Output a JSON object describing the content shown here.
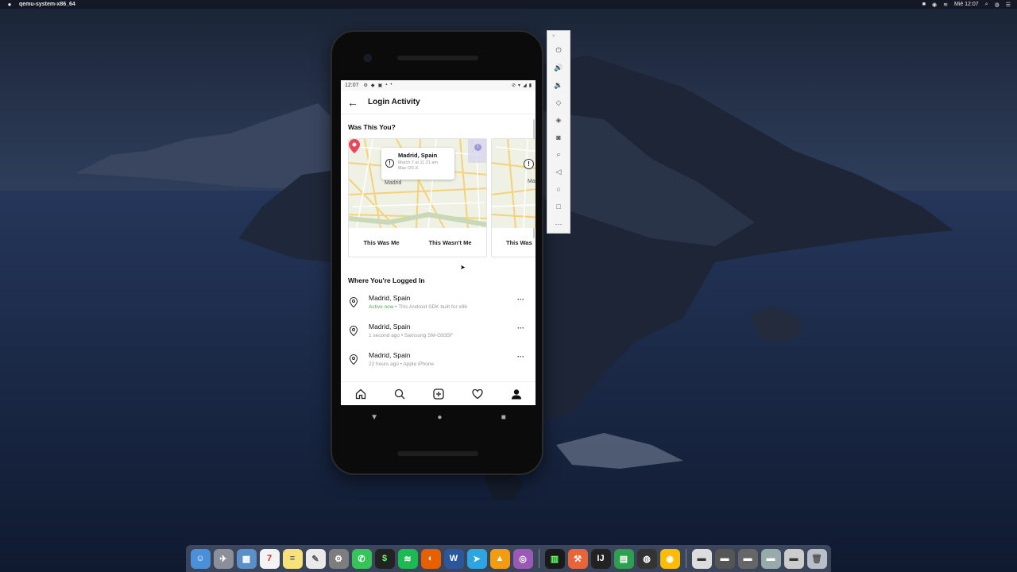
{
  "menubar": {
    "app_name": "qemu-system-x86_64",
    "clock": "Mié 12:07"
  },
  "phone_status": {
    "time": "12:07"
  },
  "appbar": {
    "title": "Login Activity"
  },
  "was_this_you": {
    "title": "Was This You?",
    "cards": [
      {
        "city": "Madrid, Spain",
        "time": "March 7 at 11:21 am",
        "device": "Mac OS X",
        "map_label": "Madrid",
        "confirm_label": "This Was Me",
        "deny_label": "This Wasn't Me"
      },
      {
        "map_label": "Ma",
        "confirm_label": "This Was"
      }
    ]
  },
  "logged_in": {
    "title": "Where You're Logged In",
    "sessions": [
      {
        "city": "Madrid, Spain",
        "status": "Active now",
        "detail": " • This Android SDK built for x86"
      },
      {
        "city": "Madrid, Spain",
        "status": "",
        "detail": "1 second ago • Samsung SM-G935F"
      },
      {
        "city": "Madrid, Spain",
        "status": "",
        "detail": "22 hours ago • Apple iPhone"
      }
    ]
  },
  "bottom_nav": [
    "home-icon",
    "search-icon",
    "add-post-icon",
    "activity-heart-icon",
    "profile-icon"
  ],
  "emulator_toolbar": [
    "power-icon",
    "volume-up-icon",
    "volume-down-icon",
    "rotate-left-icon",
    "rotate-right-icon",
    "camera-icon",
    "zoom-icon",
    "back-icon",
    "home-icon",
    "overview-icon",
    "more-icon"
  ],
  "dock_apps": [
    "Finder",
    "Launchpad",
    "Preview",
    "Calendar",
    "Notes",
    "TextEdit",
    "System Preferences",
    "WhatsApp",
    "Terminal",
    "Spotify",
    "Firefox",
    "Word",
    "Telegram",
    "VLC",
    "Podcasts",
    "Activity Monitor",
    "Instruments",
    "IntelliJ IDEA",
    "Numbers",
    "OBS",
    "Chrome",
    "Folder",
    "Folder",
    "Folder",
    "Folder",
    "Folder",
    "Trash"
  ],
  "colors": {
    "active_green": "#4caf50",
    "pin_red": "#e8465b"
  }
}
